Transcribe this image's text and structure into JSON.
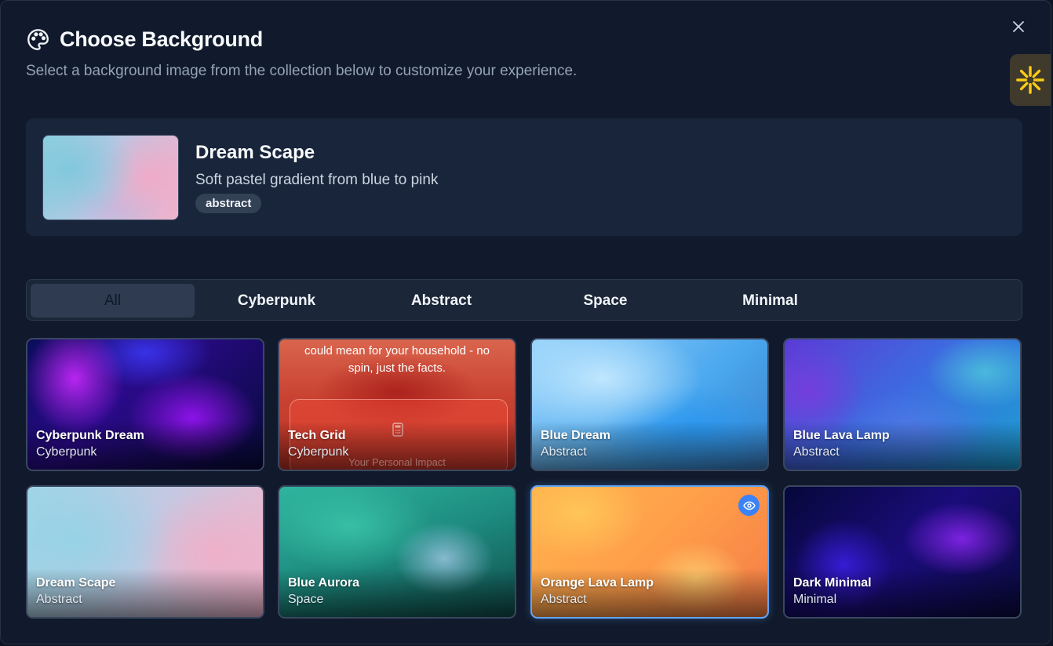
{
  "dialog": {
    "title": "Choose Background",
    "subtitle": "Select a background image from the collection below to customize your experience.",
    "title_icon": "palette-icon",
    "close_icon": "close-icon"
  },
  "side_widget": {
    "icon": "sparkle-icon",
    "color": "#facc15"
  },
  "preview": {
    "name": "Dream Scape",
    "description": "Soft pastel gradient from blue to pink",
    "tag": "abstract"
  },
  "tabs": [
    {
      "label": "All",
      "active": true
    },
    {
      "label": "Cyberpunk",
      "active": false
    },
    {
      "label": "Abstract",
      "active": false
    },
    {
      "label": "Space",
      "active": false
    },
    {
      "label": "Minimal",
      "active": false
    }
  ],
  "backgrounds": [
    {
      "name": "Cyberpunk Dream",
      "category": "Cyberpunk"
    },
    {
      "name": "Tech Grid",
      "category": "Cyberpunk",
      "overlay_line1": "could mean for your household - no",
      "overlay_line2": "spin, just the facts.",
      "overlay_small": "Your Personal Impact"
    },
    {
      "name": "Blue Dream",
      "category": "Abstract"
    },
    {
      "name": "Blue Lava Lamp",
      "category": "Abstract"
    },
    {
      "name": "Dream Scape",
      "category": "Abstract"
    },
    {
      "name": "Blue Aurora",
      "category": "Space"
    },
    {
      "name": "Orange Lava Lamp",
      "category": "Abstract",
      "selected": true,
      "preview_icon": "eye-icon"
    },
    {
      "name": "Dark Minimal",
      "category": "Minimal"
    }
  ],
  "colors": {
    "accent": "#3b82f6",
    "selected_border": "#60a5fa"
  }
}
